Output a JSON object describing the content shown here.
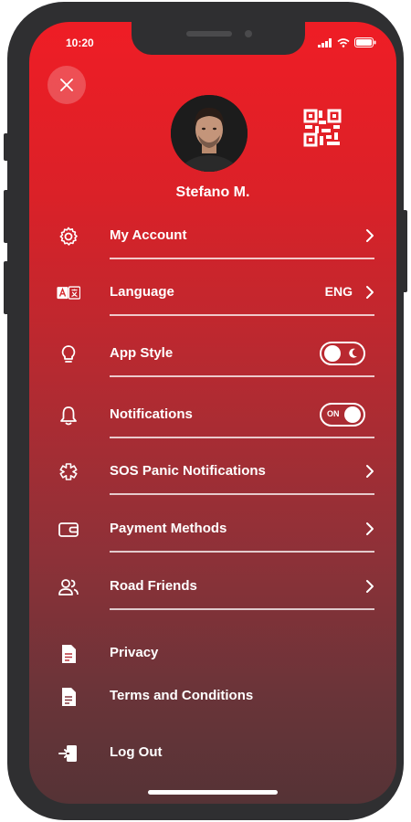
{
  "status_bar": {
    "time": "10:20"
  },
  "profile": {
    "name": "Stefano M."
  },
  "menu": {
    "my_account": {
      "label": "My Account"
    },
    "language": {
      "label": "Language",
      "value": "ENG"
    },
    "app_style": {
      "label": "App Style"
    },
    "notifications": {
      "label": "Notifications",
      "toggle_text": "ON",
      "enabled": true
    },
    "sos": {
      "label": "SOS Panic Notifications"
    },
    "payment": {
      "label": "Payment Methods"
    },
    "road_friends": {
      "label": "Road Friends"
    },
    "privacy": {
      "label": "Privacy"
    },
    "terms": {
      "label": "Terms and Conditions"
    },
    "logout": {
      "label": "Log Out"
    }
  },
  "icons": [
    "close-icon",
    "qr-code-icon",
    "gear-icon",
    "language-icon",
    "lightbulb-icon",
    "bell-icon",
    "sos-icon",
    "wallet-icon",
    "friends-icon",
    "document-icon",
    "logout-icon",
    "chevron-right-icon",
    "moon-icon"
  ],
  "colors": {
    "gradient_top": "#ef1d25",
    "gradient_bottom": "#553336",
    "text": "#ffffff",
    "device_frame": "#2f2f31"
  }
}
